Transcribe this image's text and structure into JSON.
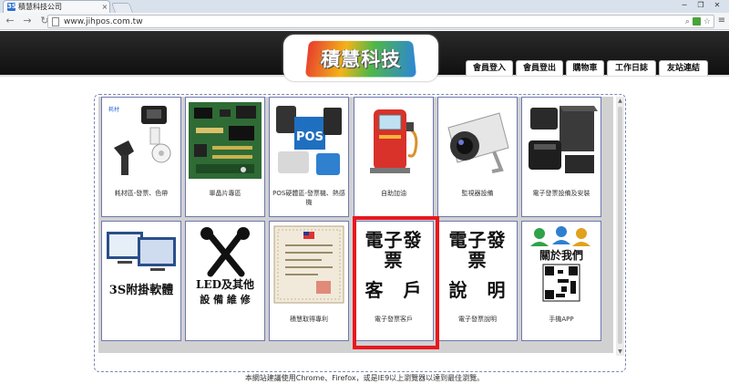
{
  "browser": {
    "tab_title": "積慧科技公司",
    "tab_close": "×",
    "favicon": "3S",
    "url": "www.jihpos.com.tw",
    "controls": [
      "─",
      "❐",
      "✕"
    ]
  },
  "site": {
    "logo_text": "積慧科技",
    "nav": [
      {
        "label": "會員登入"
      },
      {
        "label": "會員登出"
      },
      {
        "label": "購物車"
      },
      {
        "label": "工作日誌"
      },
      {
        "label": "友站連結"
      }
    ]
  },
  "products": [
    {
      "caption": "耗材區-發票、色帶",
      "icon": "barcode-scanner-icon"
    },
    {
      "caption": "單晶片專區",
      "icon": "circuit-board-icon"
    },
    {
      "caption": "POS硬體區-發票機、熱感機",
      "icon": "pos-printer-icon",
      "pos_text": "POS"
    },
    {
      "caption": "自助加油",
      "icon": "fuel-pump-icon"
    },
    {
      "caption": "監視器設備",
      "icon": "security-camera-icon"
    },
    {
      "caption": "電子發票設備及安裝",
      "icon": "invoice-printer-icon"
    },
    {
      "caption": "",
      "icon": "software-monitors-icon",
      "image_text": "3S附掛軟體"
    },
    {
      "caption": "",
      "icon": "repair-tools-icon",
      "image_text_1": "LED及其他",
      "image_text_2": "設 備 維 修"
    },
    {
      "caption": "積慧取得專利",
      "icon": "patent-certificate-icon"
    },
    {
      "caption": "電子發票客戶",
      "icon": "einvoice-clients-icon",
      "image_text_1": "電子發票",
      "image_text_2": "客　戶"
    },
    {
      "caption": "電子發票說明",
      "icon": "einvoice-info-icon",
      "image_text_1": "電子發票",
      "image_text_2": "說　明"
    },
    {
      "caption": "手機APP",
      "icon": "mobile-app-icon",
      "image_text": "關於我們"
    }
  ],
  "footer_note": "本網站建議使用Chrome、Firefox，或是IE9以上瀏覽器以達到最佳瀏覽。",
  "colors": {
    "highlight": "#e8181e",
    "frame": "#7d86b5",
    "header": "#1a1a1a"
  }
}
